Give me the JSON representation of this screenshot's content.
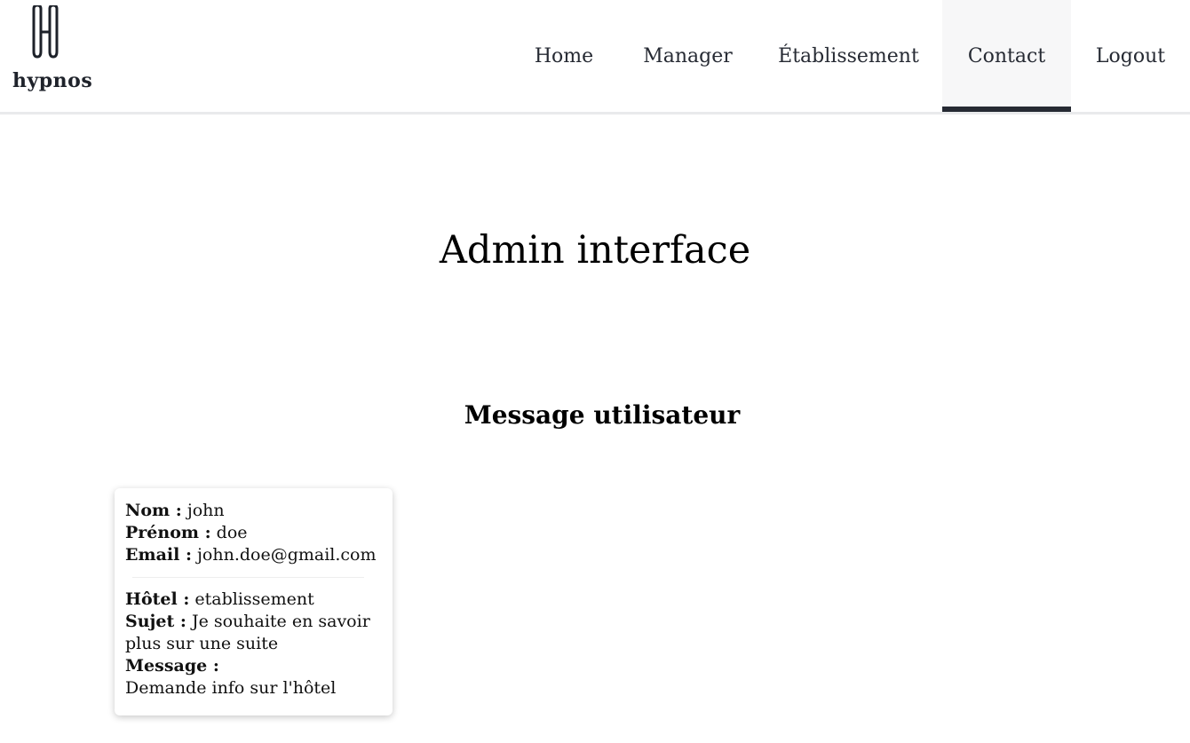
{
  "brand": {
    "name": "hypnos",
    "icon": "hotel-h-logo-icon"
  },
  "nav": {
    "items": [
      {
        "label": "Home",
        "active": false
      },
      {
        "label": "Manager",
        "active": false
      },
      {
        "label": "Établissement",
        "active": false
      },
      {
        "label": "Contact",
        "active": true
      },
      {
        "label": "Logout",
        "active": false
      }
    ]
  },
  "main": {
    "title": "Admin interface",
    "section_title": "Message utilisateur"
  },
  "message_card": {
    "nom_label": "Nom :",
    "nom": "john",
    "prenom_label": "Prénom :",
    "prenom": "doe",
    "email_label": "Email :",
    "email": "john.doe@gmail.com",
    "hotel_label": "Hôtel :",
    "hotel": "etablissement",
    "sujet_label": "Sujet :",
    "sujet": "Je souhaite en savoir plus sur une suite",
    "message_label": "Message :",
    "message": "Demande info sur l'hôtel"
  },
  "colors": {
    "nav_active_bar": "#262a33",
    "nav_active_bg": "#f7f7f8",
    "header_border": "#e9eaec"
  }
}
